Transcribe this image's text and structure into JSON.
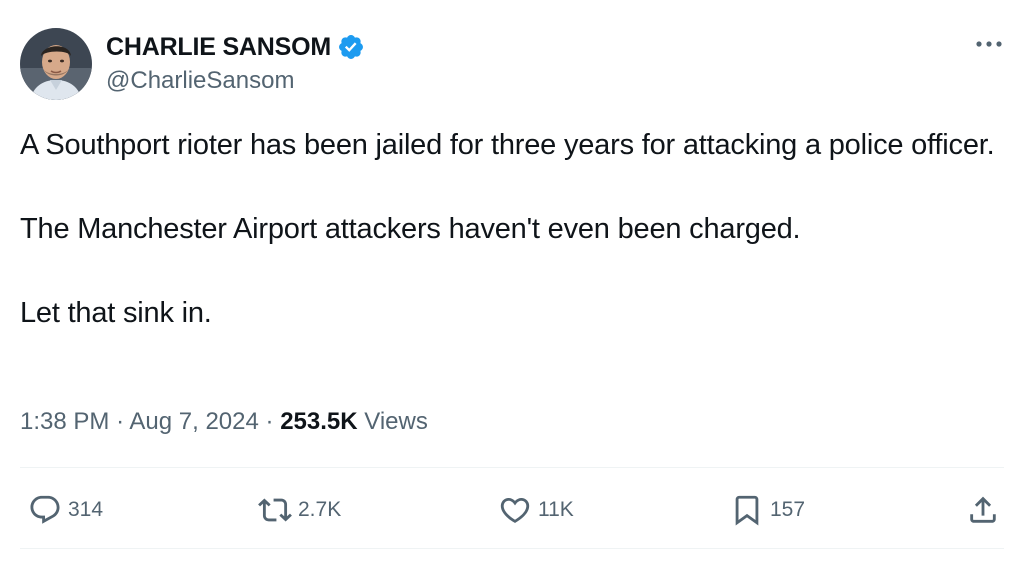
{
  "author": {
    "display_name": "CHARLIE SANSOM",
    "handle": "@CharlieSansom",
    "verified": true
  },
  "tweet": {
    "paragraphs": [
      "A Southport rioter has been jailed for three years for attacking a police officer.",
      "The Manchester Airport attackers haven't even been charged.",
      "Let that sink in."
    ],
    "time": "1:38 PM",
    "separator": "·",
    "date": "Aug 7, 2024",
    "views_count": "253.5K",
    "views_label": "Views"
  },
  "actions": {
    "reply_count": "314",
    "retweet_count": "2.7K",
    "like_count": "11K",
    "bookmark_count": "157"
  },
  "icons": {
    "more": "more-horizontal-icon",
    "verified": "verified-badge-icon",
    "reply": "reply-icon",
    "retweet": "retweet-icon",
    "like": "heart-icon",
    "bookmark": "bookmark-icon",
    "share": "share-icon"
  },
  "colors": {
    "text_primary": "#0f1419",
    "text_secondary": "#536471",
    "verified_blue": "#1d9bf0",
    "divider": "#eff3f4"
  }
}
